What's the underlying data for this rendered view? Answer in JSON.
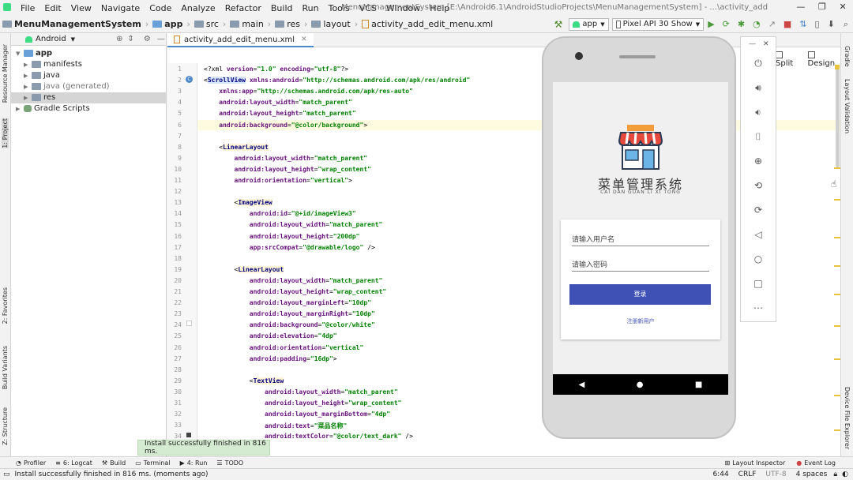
{
  "menu": [
    "File",
    "Edit",
    "View",
    "Navigate",
    "Code",
    "Analyze",
    "Refactor",
    "Build",
    "Run",
    "Tools",
    "VCS",
    "Window",
    "Help"
  ],
  "window_title": "MenuManagementSystem [E:\\Android6.1\\AndroidStudioProjects\\MenuManagementSystem] - ...\\activity_add_edit_menu.xml [app]",
  "breadcrumb": [
    "MenuManagementSystem",
    "app",
    "src",
    "main",
    "res",
    "layout",
    "activity_add_edit_menu.xml"
  ],
  "run_config": "app",
  "device": "Pixel API 30 Show",
  "project_view": "Android",
  "tree": [
    {
      "label": "app",
      "indent": 0,
      "open": true
    },
    {
      "label": "manifests",
      "indent": 1,
      "open": false
    },
    {
      "label": "java",
      "indent": 1,
      "open": false
    },
    {
      "label": "java (generated)",
      "indent": 1,
      "open": false
    },
    {
      "label": "res",
      "indent": 1,
      "open": false
    },
    {
      "label": "Gradle Scripts",
      "indent": 0,
      "open": false
    }
  ],
  "editor_tab": "activity_add_edit_menu.xml",
  "view_modes": {
    "split": "Split",
    "design": "Design"
  },
  "left_tabs": {
    "resource_manager": "Resource Manager",
    "project": "1: Project",
    "favorites": "2: Favorites",
    "build_variants": "Build Variants",
    "structure": "Z: Structure"
  },
  "right_tabs": {
    "gradle": "Gradle",
    "layout_validation": "Layout Validation",
    "device_file": "Device File Explorer"
  },
  "code_lines": [
    {
      "n": "1",
      "t": "<?xml version=\"1.0\" encoding=\"utf-8\"?>"
    },
    {
      "n": "2",
      "t": "<ScrollView xmlns:android=\"http://schemas.android.com/apk/res/android\""
    },
    {
      "n": "3",
      "t": "    xmlns:app=\"http://schemas.android.com/apk/res-auto\""
    },
    {
      "n": "4",
      "t": "    android:layout_width=\"match_parent\""
    },
    {
      "n": "5",
      "t": "    android:layout_height=\"match_parent\""
    },
    {
      "n": "6",
      "t": "    android:background=\"@color/background\">"
    },
    {
      "n": "7",
      "t": ""
    },
    {
      "n": "8",
      "t": "    <LinearLayout"
    },
    {
      "n": "9",
      "t": "        android:layout_width=\"match_parent\""
    },
    {
      "n": "10",
      "t": "        android:layout_height=\"wrap_content\""
    },
    {
      "n": "11",
      "t": "        android:orientation=\"vertical\">"
    },
    {
      "n": "12",
      "t": ""
    },
    {
      "n": "13",
      "t": "        <ImageView"
    },
    {
      "n": "14",
      "t": "            android:id=\"@+id/imageView3\""
    },
    {
      "n": "15",
      "t": "            android:layout_width=\"match_parent\""
    },
    {
      "n": "16",
      "t": "            android:layout_height=\"200dp\""
    },
    {
      "n": "17",
      "t": "            app:srcCompat=\"@drawable/logo\" />"
    },
    {
      "n": "18",
      "t": ""
    },
    {
      "n": "19",
      "t": "        <LinearLayout"
    },
    {
      "n": "20",
      "t": "            android:layout_width=\"match_parent\""
    },
    {
      "n": "21",
      "t": "            android:layout_height=\"wrap_content\""
    },
    {
      "n": "22",
      "t": "            android:layout_marginLeft=\"10dp\""
    },
    {
      "n": "23",
      "t": "            android:layout_marginRight=\"10dp\""
    },
    {
      "n": "24",
      "t": "            android:background=\"@color/white\""
    },
    {
      "n": "25",
      "t": "            android:elevation=\"4dp\""
    },
    {
      "n": "26",
      "t": "            android:orientation=\"vertical\""
    },
    {
      "n": "27",
      "t": "            android:padding=\"16dp\">"
    },
    {
      "n": "28",
      "t": ""
    },
    {
      "n": "29",
      "t": "            <TextView"
    },
    {
      "n": "30",
      "t": "                android:layout_width=\"match_parent\""
    },
    {
      "n": "31",
      "t": "                android:layout_height=\"wrap_content\""
    },
    {
      "n": "32",
      "t": "                android:layout_marginBottom=\"4dp\""
    },
    {
      "n": "33",
      "t": "                android:text=\"菜品名称\""
    },
    {
      "n": "34",
      "t": "                android:textColor=\"@color/text_dark\" />"
    }
  ],
  "app_screen": {
    "logo_title": "菜单管理系统",
    "logo_subtitle": "CAI DAN GUAN LI XI TONG",
    "username_placeholder": "请输入用户名",
    "password_placeholder": "请输入密码",
    "login_label": "登录",
    "register_label": "注册新用户"
  },
  "bottom_tabs": {
    "profiler": "Profiler",
    "logcat": "6: Logcat",
    "build": "Build",
    "terminal": "Terminal",
    "run": "4: Run",
    "todo": "TODO",
    "layout_inspector": "Layout Inspector",
    "event_log": "Event Log"
  },
  "toast": "Install successfully finished in 816 ms.",
  "status": {
    "message": "Install successfully finished in 816 ms. (moments ago)",
    "position": "6:44",
    "line_sep": "CRLF",
    "encoding": "UTF-8",
    "indent": "4 spaces"
  },
  "colors": {
    "accent": "#4a88c7",
    "login_button": "#3f51b5",
    "code_tag": "#000080",
    "code_attr": "#660e7a",
    "code_str": "#008000"
  },
  "icons": [
    "hammer-icon",
    "run-icon",
    "debug-icon",
    "settings-icon",
    "search-icon",
    "power-icon",
    "volume-up-icon",
    "volume-down-icon",
    "camera-icon",
    "zoom-icon",
    "rotate-icon",
    "back-icon",
    "home-icon",
    "overview-icon",
    "more-icon"
  ]
}
